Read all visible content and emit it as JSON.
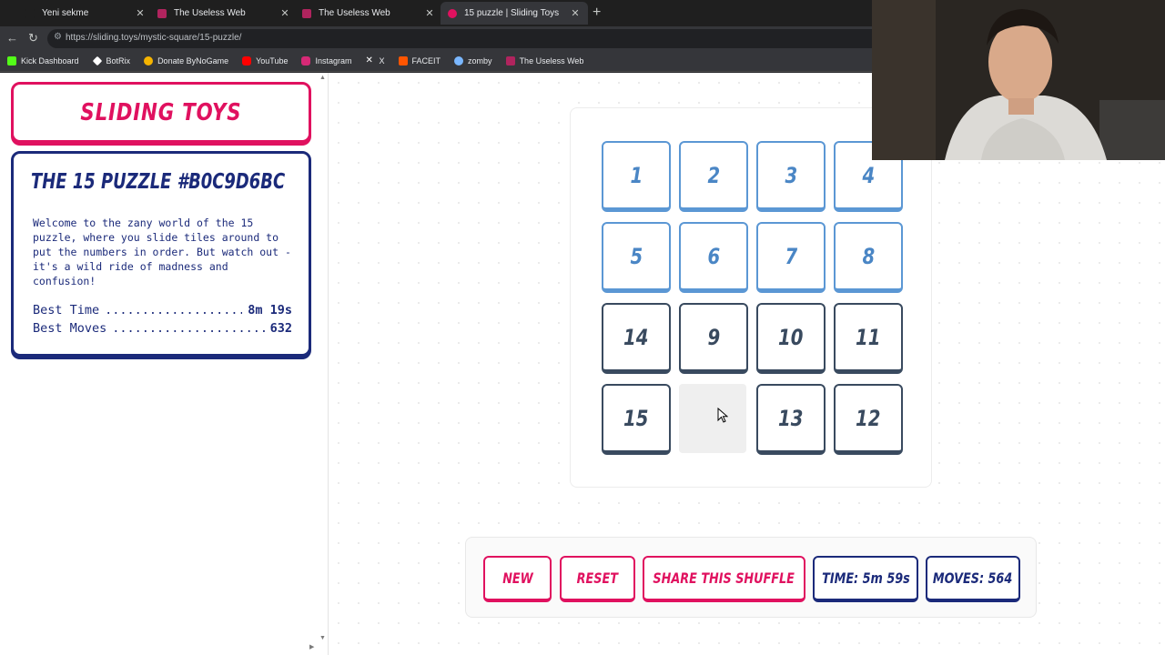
{
  "browser": {
    "tabs": [
      {
        "title": "Yeni sekme",
        "fav_color": "#1f1f1f",
        "active": false
      },
      {
        "title": "The Useless Web",
        "fav_color": "#b0245e",
        "active": false
      },
      {
        "title": "The Useless Web",
        "fav_color": "#b0245e",
        "active": false
      },
      {
        "title": "15 puzzle | Sliding Toys",
        "fav_color": "#e0115f",
        "active": true
      }
    ],
    "url": "https://sliding.toys/mystic-square/15-puzzle/",
    "bookmarks": [
      {
        "label": "Kick Dashboard",
        "color": "#53fc18"
      },
      {
        "label": "BotRix",
        "color": "#ffffff"
      },
      {
        "label": "Donate ByNoGame",
        "color": "#f5b400"
      },
      {
        "label": "YouTube",
        "color": "#ff0000"
      },
      {
        "label": "Instagram",
        "color": "#d62976"
      },
      {
        "label": "X",
        "color": "#ffffff"
      },
      {
        "label": "FACEIT",
        "color": "#ff5500"
      },
      {
        "label": "zomby",
        "color": "#7ab7ff"
      },
      {
        "label": "The Useless Web",
        "color": "#b0245e"
      }
    ]
  },
  "sidebar": {
    "logo": "SLIDING TOYS",
    "puzzle_title": "THE 15 PUZZLE #B0C9D6BC",
    "description": "Welcome to the zany world of the 15 puzzle, where you slide tiles around to put the numbers in order. But watch out - it's a wild ride of madness and confusion!",
    "best_time_label": "Best Time",
    "best_time_value": "8m 19s",
    "best_moves_label": "Best Moves",
    "best_moves_value": "632"
  },
  "board": {
    "tiles": [
      [
        "1",
        "2",
        "3",
        "4"
      ],
      [
        "5",
        "6",
        "7",
        "8"
      ],
      [
        "14",
        "9",
        "10",
        "11"
      ],
      [
        "15",
        "",
        "13",
        "12"
      ]
    ],
    "correct": [
      [
        true,
        true,
        true,
        true
      ],
      [
        true,
        true,
        true,
        true
      ],
      [
        false,
        false,
        false,
        false
      ],
      [
        false,
        false,
        false,
        false
      ]
    ]
  },
  "controls": {
    "new_label": "NEW",
    "reset_label": "RESET",
    "share_label": "SHARE THIS SHUFFLE",
    "time_label": "TIME: 5m 59s",
    "moves_label": "MOVES: 564"
  },
  "colors": {
    "brand_pink": "#e0115f",
    "brand_navy": "#1b2a7a",
    "tile_correct": "#5b97d4",
    "tile_wrong": "#394a5f"
  }
}
